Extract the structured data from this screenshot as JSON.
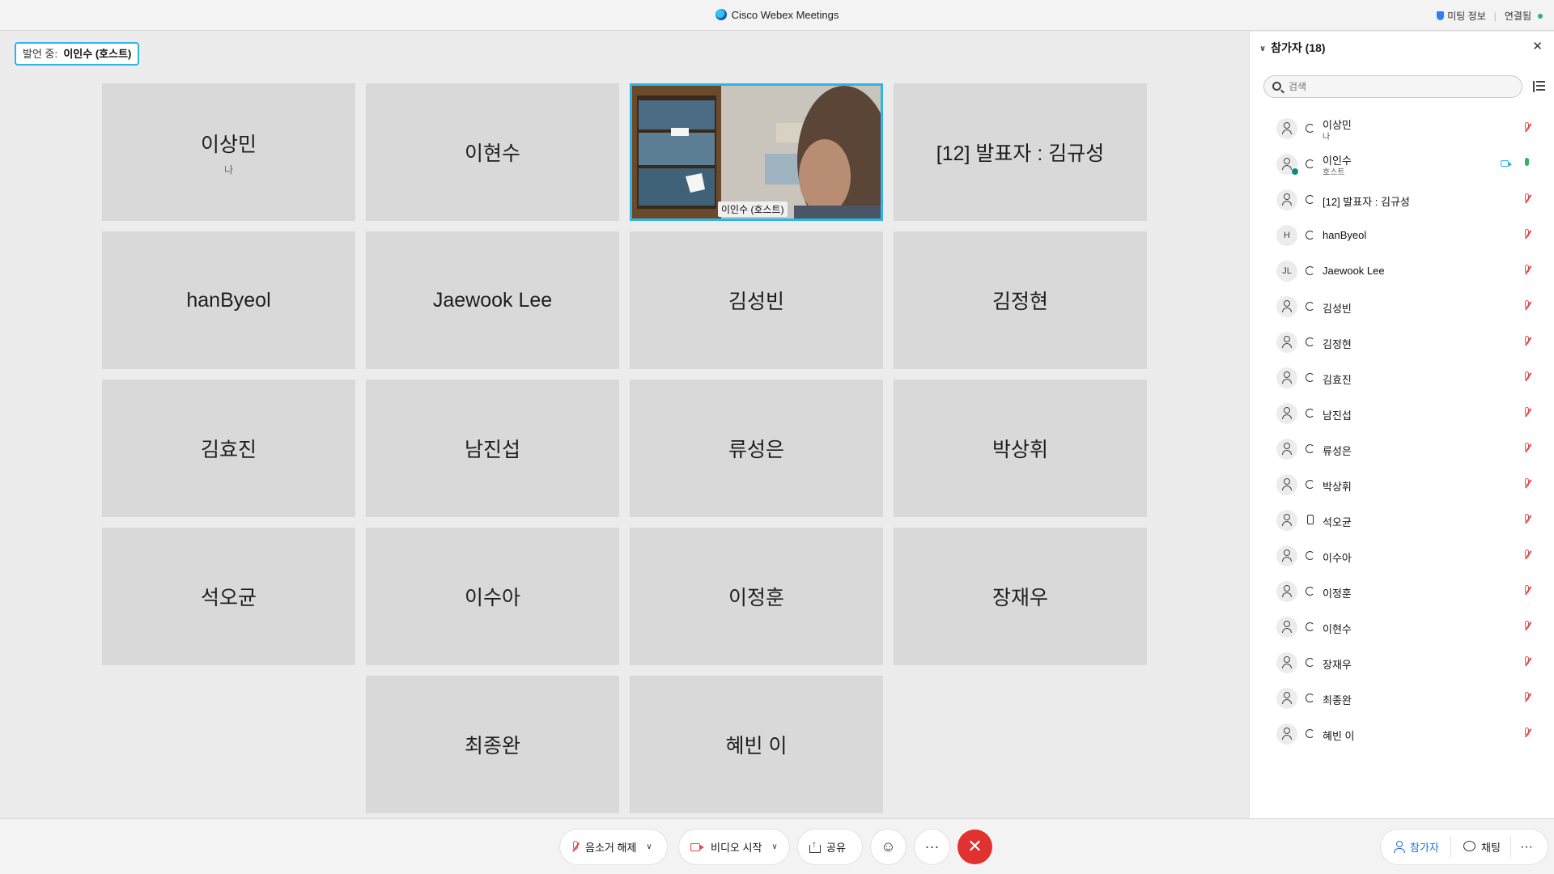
{
  "titlebar": {
    "app_title": "Cisco Webex Meetings",
    "meeting_info": "미팅 정보",
    "connected": "연결됨"
  },
  "stage": {
    "speaking_prefix": "발언 중:",
    "speaking_name": "이인수 (호스트)",
    "tiles": [
      {
        "name": "이상민",
        "sub": "나"
      },
      {
        "name": "이현수",
        "sub": ""
      },
      {
        "name": "",
        "sub": "",
        "video_label": "이인수 (호스트)"
      },
      {
        "name": "[12] 발표자 : 김규성",
        "sub": ""
      },
      {
        "name": "hanByeol",
        "sub": ""
      },
      {
        "name": "Jaewook Lee",
        "sub": ""
      },
      {
        "name": "김성빈",
        "sub": ""
      },
      {
        "name": "김정현",
        "sub": ""
      },
      {
        "name": "김효진",
        "sub": ""
      },
      {
        "name": "남진섭",
        "sub": ""
      },
      {
        "name": "류성은",
        "sub": ""
      },
      {
        "name": "박상휘",
        "sub": ""
      },
      {
        "name": "석오균",
        "sub": ""
      },
      {
        "name": "이수아",
        "sub": ""
      },
      {
        "name": "이정훈",
        "sub": ""
      },
      {
        "name": "장재우",
        "sub": ""
      },
      {
        "name": "최종완",
        "sub": ""
      },
      {
        "name": "혜빈 이",
        "sub": ""
      }
    ]
  },
  "panel": {
    "title": "참가자 (18)",
    "search_placeholder": "검색",
    "participants": [
      {
        "name": "이상민",
        "sub": "나",
        "avatar": "person-icon",
        "conn": "audio",
        "mic": "muted"
      },
      {
        "name": "이인수",
        "sub": "호스트",
        "avatar": "person-icon",
        "conn": "audio",
        "mic": "on",
        "video": true,
        "host": true
      },
      {
        "name": "[12] 발표자 : 김규성",
        "sub": "",
        "avatar": "person-icon",
        "conn": "audio",
        "mic": "muted"
      },
      {
        "name": "hanByeol",
        "sub": "",
        "avatar": "H",
        "conn": "audio",
        "mic": "muted"
      },
      {
        "name": "Jaewook Lee",
        "sub": "",
        "avatar": "JL",
        "conn": "audio",
        "mic": "muted"
      },
      {
        "name": "김성빈",
        "sub": "",
        "avatar": "person-icon",
        "conn": "audio",
        "mic": "muted"
      },
      {
        "name": "김정현",
        "sub": "",
        "avatar": "person-icon",
        "conn": "audio",
        "mic": "muted"
      },
      {
        "name": "김효진",
        "sub": "",
        "avatar": "person-icon",
        "conn": "audio",
        "mic": "muted"
      },
      {
        "name": "남진섭",
        "sub": "",
        "avatar": "person-icon",
        "conn": "audio",
        "mic": "muted"
      },
      {
        "name": "류성은",
        "sub": "",
        "avatar": "person-icon",
        "conn": "audio",
        "mic": "muted"
      },
      {
        "name": "박상휘",
        "sub": "",
        "avatar": "person-icon",
        "conn": "audio",
        "mic": "muted"
      },
      {
        "name": "석오균",
        "sub": "",
        "avatar": "person-icon",
        "conn": "phone",
        "mic": "muted"
      },
      {
        "name": "이수아",
        "sub": "",
        "avatar": "person-icon",
        "conn": "audio",
        "mic": "muted"
      },
      {
        "name": "이정훈",
        "sub": "",
        "avatar": "person-icon",
        "conn": "audio",
        "mic": "muted"
      },
      {
        "name": "이현수",
        "sub": "",
        "avatar": "person-icon",
        "conn": "audio",
        "mic": "muted"
      },
      {
        "name": "장재우",
        "sub": "",
        "avatar": "person-icon",
        "conn": "audio",
        "mic": "muted"
      },
      {
        "name": "최종완",
        "sub": "",
        "avatar": "person-icon",
        "conn": "audio",
        "mic": "muted"
      },
      {
        "name": "혜빈 이",
        "sub": "",
        "avatar": "person-icon",
        "conn": "audio",
        "mic": "muted"
      }
    ]
  },
  "controls": {
    "unmute": "음소거 해제",
    "start_video": "비디오 시작",
    "share": "공유",
    "participants": "참가자",
    "chat": "채팅"
  },
  "colors": {
    "accent": "#2fb4e6",
    "end_call": "#e0322e",
    "muted": "#e5484d",
    "active": "#2fb36a"
  }
}
